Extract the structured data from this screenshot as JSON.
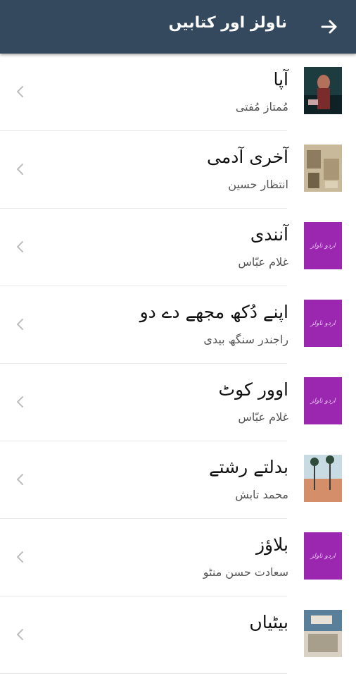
{
  "header": {
    "title": "ناولز اور کتابیں",
    "back_icon": "arrow-right-icon",
    "background": "#34495e"
  },
  "placeholder_color": "#9b27b0",
  "placeholder_mark": "اردو ناولز",
  "items": [
    {
      "title": "آپا",
      "author": "مُمتاز مُفتی",
      "thumb": "image"
    },
    {
      "title": "آخری آدمی",
      "author": "انتظار حسین",
      "thumb": "image"
    },
    {
      "title": "آنندی",
      "author": "غلام عبّاس",
      "thumb": "placeholder"
    },
    {
      "title": "اپنے دُکھ مجھے دے دو",
      "author": "راجندر سنگھ بیدی",
      "thumb": "placeholder"
    },
    {
      "title": "اوور کوٹ",
      "author": "غلام عبّاس",
      "thumb": "placeholder"
    },
    {
      "title": "بدلتے رشتے",
      "author": "محمد تابش",
      "thumb": "image"
    },
    {
      "title": "بلاؤز",
      "author": "سعادت حسن منٹو",
      "thumb": "placeholder"
    },
    {
      "title": "بیٹیاں",
      "author": "",
      "thumb": "image"
    }
  ]
}
